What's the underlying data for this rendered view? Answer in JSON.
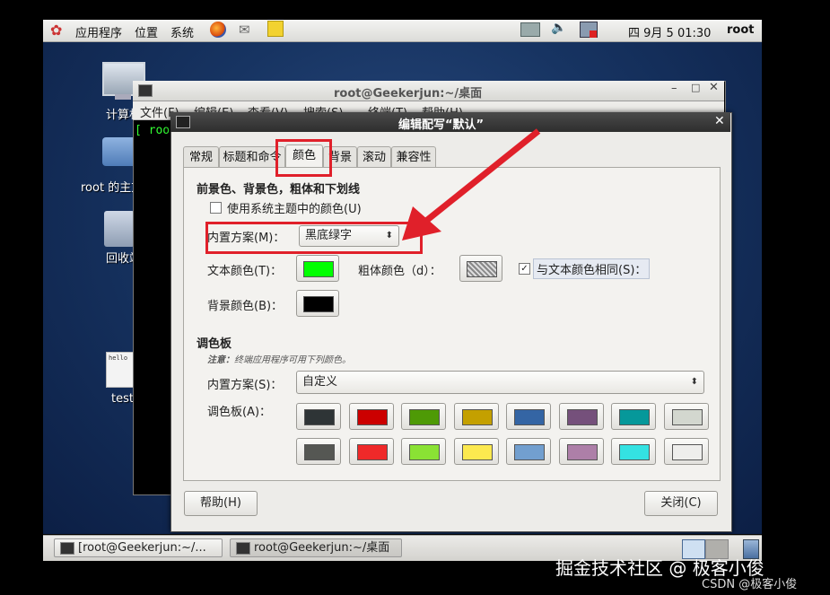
{
  "top_panel": {
    "apps": "应用程序",
    "places": "位置",
    "system": "系统",
    "datetime": "四 9月  5 01:30",
    "user": "root"
  },
  "desktop_icons": [
    {
      "label": "计算机"
    },
    {
      "label": "root 的主文件夹"
    },
    {
      "label": "回收站"
    },
    {
      "label": "test",
      "thumb_text": "hello"
    }
  ],
  "terminal": {
    "title": "root@Geekerjun:~/桌面",
    "menu": [
      "文件(F)",
      "编辑(E)",
      "查看(V)",
      "搜索(S)",
      "终端(T)",
      "帮助(H)"
    ],
    "prompt": "[ root"
  },
  "dialog": {
    "title": "编辑配写“默认”",
    "tabs": [
      "常规",
      "标题和命令",
      "颜色",
      "背景",
      "滚动",
      "兼容性"
    ],
    "active_tab": "颜色",
    "section1_title": "前景色、背景色，粗体和下划线",
    "use_system_theme": "使用系统主题中的颜色(U)",
    "builtin_scheme_label": "内置方案(M)：",
    "builtin_scheme_value": "黑底绿字",
    "text_color_label": "文本颜色(T)：",
    "text_color": "#00ff00",
    "bold_color_label": "粗体颜色（d）：",
    "same_as_text": "与文本颜色相同(S)：",
    "same_as_text_checked": true,
    "bg_color_label": "背景颜色(B)：",
    "bg_color": "#000000",
    "section2_title": "调色板",
    "note_prefix": "注意：",
    "note_text": "终端应用程序可用下列颜色。",
    "palette_scheme_label": "内置方案(S)：",
    "palette_scheme_value": "自定义",
    "palette_label": "调色板(A)：",
    "palette_row1": [
      "#2e3436",
      "#cc0000",
      "#4e9a06",
      "#c4a000",
      "#3465a4",
      "#75507b",
      "#06989a",
      "#d3d7cf"
    ],
    "palette_row2": [
      "#555753",
      "#ef2929",
      "#8ae234",
      "#fce94f",
      "#729fcf",
      "#ad7fa8",
      "#34e2e2",
      "#eeeeec"
    ],
    "help_button": "帮助(H)",
    "close_button": "关闭(C)"
  },
  "taskbar": {
    "items": [
      "[root@Geekerjun:~/...",
      "root@Geekerjun:~/桌面"
    ]
  },
  "watermark": {
    "main": "掘金技术社区 @ 极客小俊",
    "sub": "CSDN @极客小俊"
  },
  "colors": {
    "annotation_red": "#e0202a",
    "desktop_blue": "#173462"
  }
}
